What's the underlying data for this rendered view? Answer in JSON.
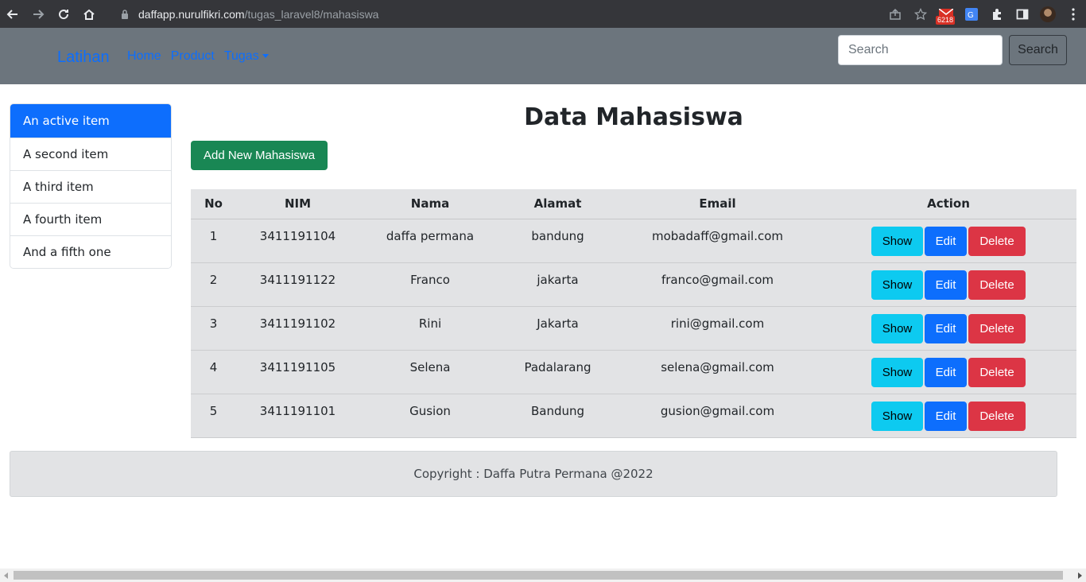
{
  "browser": {
    "url_host": "daffapp.nurulfikri.com",
    "url_path": "/tugas_laravel8/mahasiswa",
    "mail_badge": "6218"
  },
  "navbar": {
    "brand": "Latihan",
    "links": [
      "Home",
      "Product",
      "Tugas"
    ],
    "search_placeholder": "Search",
    "search_button": "Search"
  },
  "sidebar": {
    "items": [
      "An active item",
      "A second item",
      "A third item",
      "A fourth item",
      "And a fifth one"
    ]
  },
  "main": {
    "title": "Data Mahasiswa",
    "add_button": "Add New Mahasiswa",
    "columns": [
      "No",
      "NIM",
      "Nama",
      "Alamat",
      "Email",
      "Action"
    ],
    "rows": [
      {
        "no": "1",
        "nim": "3411191104",
        "nama": "daffa permana",
        "alamat": "bandung",
        "email": "mobadaff@gmail.com"
      },
      {
        "no": "2",
        "nim": "3411191122",
        "nama": "Franco",
        "alamat": "jakarta",
        "email": "franco@gmail.com"
      },
      {
        "no": "3",
        "nim": "3411191102",
        "nama": "Rini",
        "alamat": "Jakarta",
        "email": "rini@gmail.com"
      },
      {
        "no": "4",
        "nim": "3411191105",
        "nama": "Selena",
        "alamat": "Padalarang",
        "email": "selena@gmail.com"
      },
      {
        "no": "5",
        "nim": "3411191101",
        "nama": "Gusion",
        "alamat": "Bandung",
        "email": "gusion@gmail.com"
      }
    ],
    "actions": {
      "show": "Show",
      "edit": "Edit",
      "delete": "Delete"
    }
  },
  "footer": {
    "text": "Copyright : Daffa Putra Permana @2022"
  },
  "colors": {
    "primary": "#0d6efd",
    "success": "#198754",
    "info": "#0dcaf0",
    "danger": "#dc3545",
    "navbar": "#6c757d",
    "table": "#e2e3e5"
  }
}
